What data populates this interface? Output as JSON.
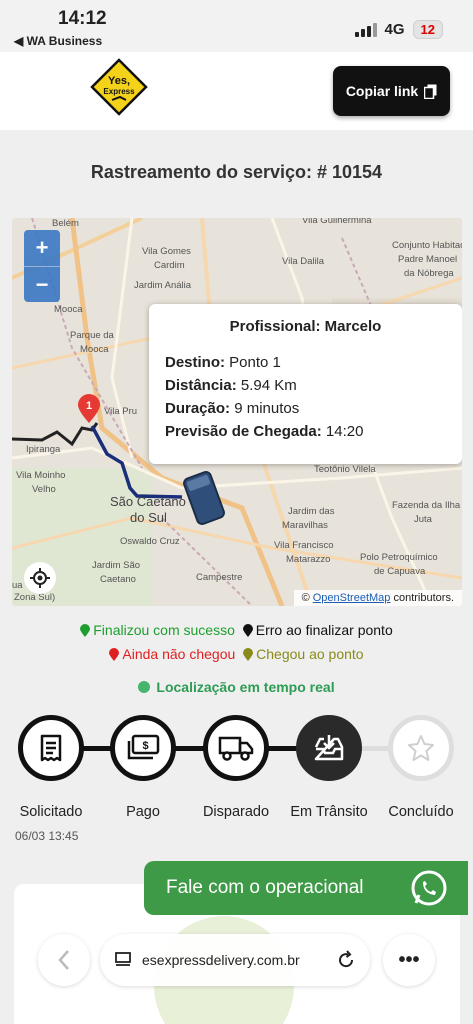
{
  "status_bar": {
    "time": "14:12",
    "back_label": "◀ WA Business",
    "network": "4G",
    "battery": "12"
  },
  "header": {
    "logo_text_top": "Yes,",
    "logo_text_bottom": "Express",
    "copy_link_label": "Copiar link"
  },
  "page": {
    "title": "Rastreamento do serviço: # 10154"
  },
  "map": {
    "popup": {
      "title": "Profissional: Marcelo",
      "destino_label": "Destino:",
      "destino_value": "Ponto 1",
      "distancia_label": "Distância:",
      "distancia_value": "5.94 Km",
      "duracao_label": "Duração:",
      "duracao_value": "9 minutos",
      "previsao_label": "Previsão de Chegada:",
      "previsao_value": "14:20"
    },
    "pin_number": "1",
    "attribution_prefix": "©",
    "attribution_link": "OpenStreetMap",
    "attribution_suffix": "contributors.",
    "labels": [
      "Belém",
      "Vila Guilhermina",
      "Conjunto Habitac",
      "Vila Gomes",
      "Vila Dalila",
      "Padre Manoel",
      "Cardim",
      "da Nóbrega",
      "Jardim Anália",
      "Mooca",
      "Parque da",
      "Mooca",
      "Vila Pru",
      "Ipiranga",
      "Vila Moinho",
      "Velho",
      "Teotônio Vilela",
      "Fazenda da Ilha",
      "Juta",
      "São Caetano",
      "do Sul",
      "Jardim das",
      "Maravilhas",
      "Oswaldo Cruz",
      "Vila Francisco",
      "Matarazzo",
      "Polo Petroquímico",
      "de Capuava",
      "Jardim São",
      "Caetano",
      "Campestre",
      "Zona Sul)",
      "ua"
    ],
    "zoom_in": "+",
    "zoom_out": "−"
  },
  "legend": {
    "success": "Finalizou com sucesso",
    "error": "Erro ao finalizar ponto",
    "not_arrived": "Ainda não chegou",
    "arrived": "Chegou ao ponto",
    "realtime": "Localização em tempo real"
  },
  "steps": [
    {
      "label": "Solicitado",
      "icon": "receipt-icon",
      "state": "done"
    },
    {
      "label": "Pago",
      "icon": "money-icon",
      "state": "done"
    },
    {
      "label": "Disparado",
      "icon": "truck-icon",
      "state": "done"
    },
    {
      "label": "Em Trânsito",
      "icon": "inbox-download-icon",
      "state": "active"
    },
    {
      "label": "Concluído",
      "icon": "star-icon",
      "state": "pending"
    }
  ],
  "step_date": "06/03 13:45",
  "whatsapp_label": "Fale com o operacional",
  "browser": {
    "url": "esexpressdelivery.com.br"
  },
  "colors": {
    "success": "#1e9e2e",
    "error": "#111111",
    "not_arrived": "#e02020",
    "arrived": "#8a8a1a",
    "realtime": "#2e9c54",
    "whatsapp": "#3f9a47",
    "logo_yellow": "#f5d21a"
  }
}
